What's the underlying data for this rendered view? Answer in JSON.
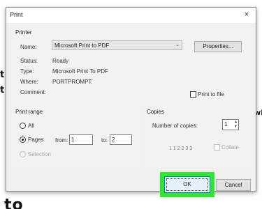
{
  "background": {
    "frag_a": "t",
    "frag_b": "t",
    "frag_c": "wi",
    "frag_d": "to"
  },
  "dialog": {
    "title": "Print",
    "close_glyph": "×",
    "printer": {
      "group_label": "Printer",
      "name_label": "Name:",
      "name_value": "Microsoft Print to PDF",
      "properties_button": "Properties...",
      "status_label": "Status:",
      "status_value": "Ready",
      "type_label": "Type:",
      "type_value": "Microsoft Print To PDF",
      "where_label": "Where:",
      "where_value": "PORTPROMPT:",
      "comment_label": "Comment:",
      "print_to_file_label": "Print to file",
      "print_to_file_checked": false
    },
    "print_range": {
      "group_label": "Print range",
      "all_label": "All",
      "pages_label": "Pages",
      "selected": "Pages",
      "from_label": "from:",
      "from_value": "1",
      "to_label": "to:",
      "to_value": "2",
      "selection_label": "Selection"
    },
    "copies": {
      "group_label": "Copies",
      "number_label": "Number of copies:",
      "number_value": "1",
      "collate_label": "Collate",
      "collate_icon_text": "1 1 2 2 3 3"
    },
    "buttons": {
      "ok": "OK",
      "cancel": "Cancel"
    },
    "colors": {
      "highlight": "#2ee82e",
      "ok_border": "#0078d7"
    }
  }
}
